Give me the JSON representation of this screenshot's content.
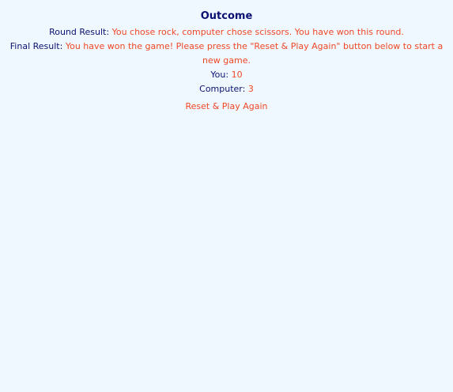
{
  "outcome": {
    "title": "Outcome",
    "round_label": "Round Result:",
    "round_text": "You chose rock, computer chose scissors. You have won this round.",
    "final_label": "Final Result:",
    "final_text": "You have won the game! Please press the \"Reset & Play Again\" button below to start a new game.",
    "you_label": "You:",
    "you_score": "10",
    "computer_label": "Computer:",
    "computer_score": "3",
    "reset_label": "Reset & Play Again"
  },
  "colors": {
    "background": "#f0f8ff",
    "label": "#0a1172",
    "accent": "#ef4826"
  }
}
